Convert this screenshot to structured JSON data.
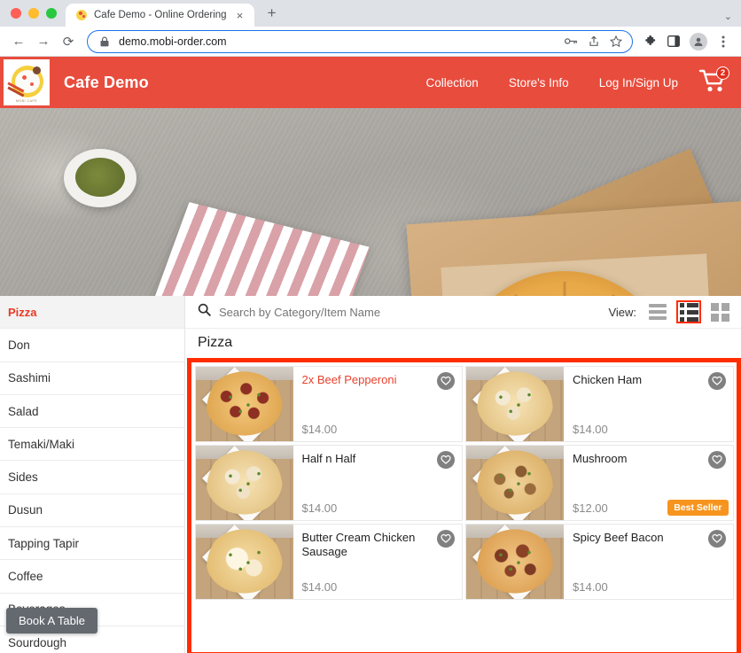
{
  "browser": {
    "tab": {
      "title": "Cafe Demo - Online Ordering",
      "favicon": "cafe-logo-icon",
      "close": "×"
    },
    "new_tab": "+",
    "tabstrip_menu": "⌄",
    "nav": {
      "back": "←",
      "forward": "→",
      "reload": "⟳"
    },
    "url": "demo.mobi-order.com",
    "lock_icon": "🔒",
    "omnibox_icons": [
      "key-icon",
      "share-icon",
      "bookmark-star-icon"
    ],
    "toolbar_icons": [
      "extensions-puzzle-icon",
      "side-panel-icon",
      "profile-avatar",
      "chrome-menu-icon"
    ]
  },
  "site": {
    "brand": "Cafe Demo",
    "logo_caption": "MOBI CAFE",
    "nav": [
      {
        "label": "Collection"
      },
      {
        "label": "Store's Info"
      },
      {
        "label": "Log In/Sign Up"
      }
    ],
    "cart": {
      "icon": "shopping-cart-icon",
      "badge": "2"
    },
    "header_color": "#e84c3d"
  },
  "sidebar": {
    "items": [
      {
        "label": "Pizza",
        "active": true
      },
      {
        "label": "Don",
        "active": false
      },
      {
        "label": "Sashimi",
        "active": false
      },
      {
        "label": "Salad",
        "active": false
      },
      {
        "label": "Temaki/Maki",
        "active": false
      },
      {
        "label": "Sides",
        "active": false
      },
      {
        "label": "Dusun",
        "active": false
      },
      {
        "label": "Tapping Tapir",
        "active": false
      },
      {
        "label": "Coffee",
        "active": false
      },
      {
        "label": "Beverages",
        "active": false
      },
      {
        "label": "Sourdough",
        "active": false
      }
    ],
    "book_table_button": "Book A Table"
  },
  "search": {
    "placeholder": "Search by Category/Item Name",
    "value": "",
    "icon": "search-icon"
  },
  "view": {
    "label": "View:",
    "options": [
      "list-view",
      "detail-list-view",
      "grid-view"
    ],
    "selected": "detail-list-view",
    "highlight_color": "#ff2d00"
  },
  "catalog": {
    "title": "Pizza",
    "items": [
      {
        "name": "2x Beef Pepperoni",
        "price": "$14.00",
        "selected": true,
        "badge": "",
        "fav_icon": "heart-icon",
        "art": "p-pepperoni"
      },
      {
        "name": "Chicken Ham",
        "price": "$14.00",
        "selected": false,
        "badge": "",
        "fav_icon": "heart-icon",
        "art": "p-chicken"
      },
      {
        "name": "Half n Half",
        "price": "$14.00",
        "selected": false,
        "badge": "",
        "fav_icon": "heart-icon",
        "art": "p-chicken"
      },
      {
        "name": "Mushroom",
        "price": "$12.00",
        "selected": false,
        "badge": "Best Seller",
        "fav_icon": "heart-icon",
        "art": "p-mushroom"
      },
      {
        "name": "Butter Cream Chicken Sausage",
        "price": "$14.00",
        "selected": false,
        "badge": "",
        "fav_icon": "heart-icon",
        "art": "p-butter"
      },
      {
        "name": "Spicy Beef Bacon",
        "price": "$14.00",
        "selected": false,
        "badge": "",
        "fav_icon": "heart-icon",
        "art": "p-spicy"
      }
    ],
    "badge_color": "#f7941e"
  }
}
